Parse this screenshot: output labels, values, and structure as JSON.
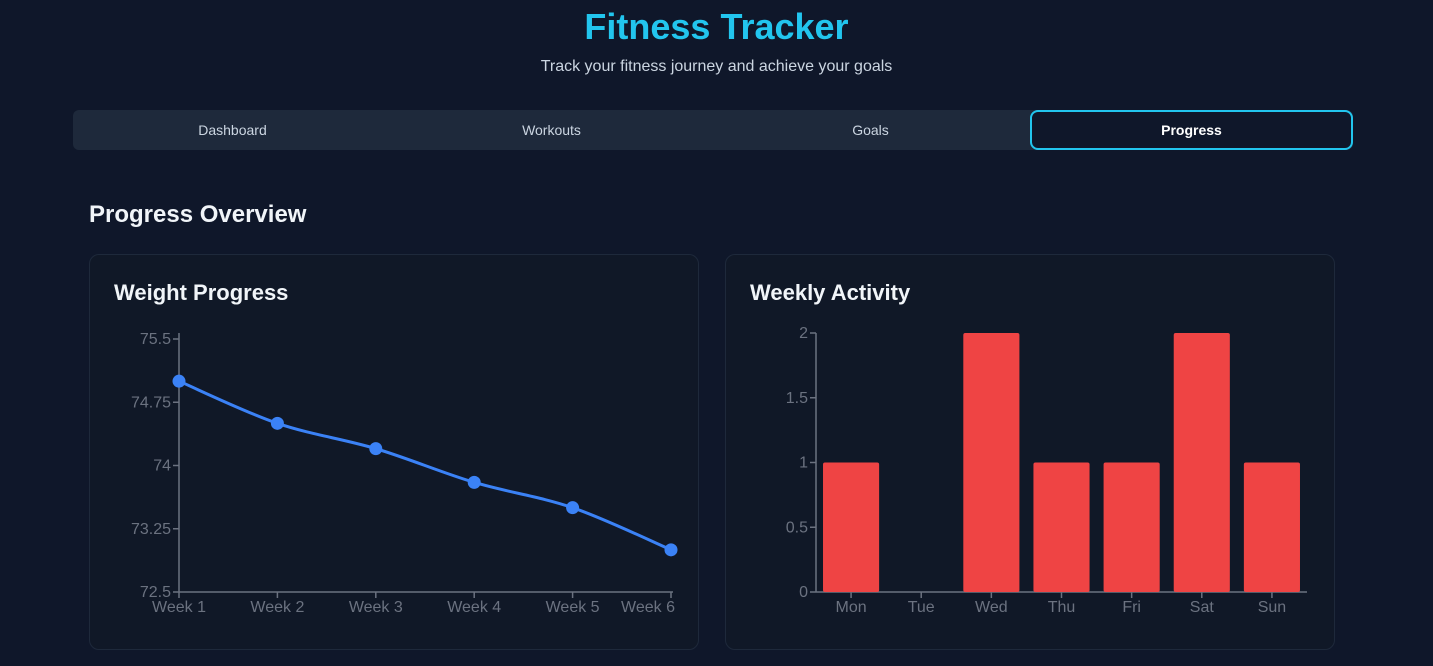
{
  "header": {
    "title": "Fitness Tracker",
    "subtitle": "Track your fitness journey and achieve your goals"
  },
  "tabs": [
    {
      "label": "Dashboard",
      "active": false
    },
    {
      "label": "Workouts",
      "active": false
    },
    {
      "label": "Goals",
      "active": false
    },
    {
      "label": "Progress",
      "active": true
    }
  ],
  "section": {
    "title": "Progress Overview"
  },
  "colors": {
    "accent": "#22c5ee",
    "line": "#3b82f6",
    "bar": "#ef4444",
    "axis": "#6b7280"
  },
  "chart_data": [
    {
      "type": "line",
      "title": "Weight Progress",
      "x": [
        "Week 1",
        "Week 2",
        "Week 3",
        "Week 4",
        "Week 5",
        "Week 6"
      ],
      "series": [
        {
          "values": [
            75.0,
            74.5,
            74.2,
            73.8,
            73.5,
            73.0
          ]
        }
      ],
      "ylim": [
        72.5,
        75.5
      ],
      "yticks": [
        72.5,
        73.25,
        74,
        74.75,
        75.5
      ],
      "ytick_labels": [
        "72.5",
        "73.25",
        "74",
        "74.75",
        "75.5"
      ],
      "grid": false,
      "xlabel": "",
      "ylabel": ""
    },
    {
      "type": "bar",
      "title": "Weekly Activity",
      "categories": [
        "Mon",
        "Tue",
        "Wed",
        "Thu",
        "Fri",
        "Sat",
        "Sun"
      ],
      "values": [
        1,
        0,
        2,
        1,
        1,
        2,
        1
      ],
      "ylim": [
        0,
        2
      ],
      "yticks": [
        0,
        0.5,
        1,
        1.5,
        2
      ],
      "ytick_labels": [
        "0",
        "0.5",
        "1",
        "1.5",
        "2"
      ],
      "grid": false,
      "xlabel": "",
      "ylabel": ""
    }
  ]
}
